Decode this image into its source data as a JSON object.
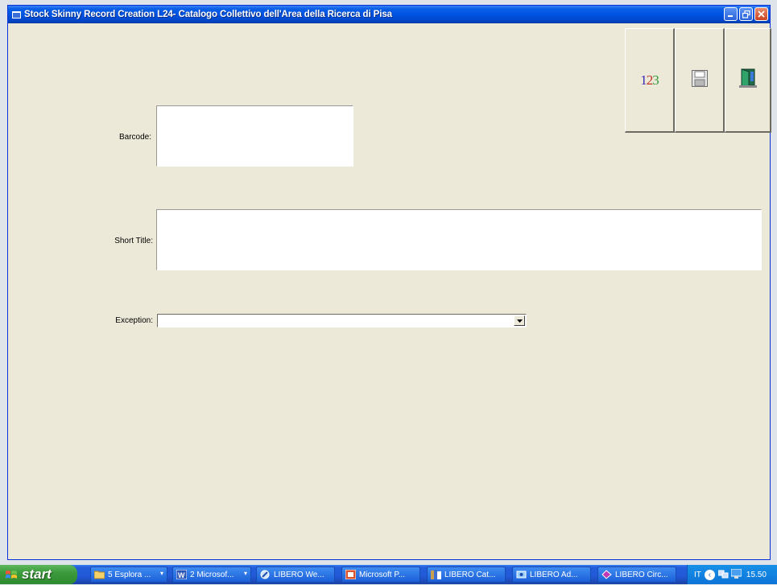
{
  "window": {
    "title": "Stock Skinny Record Creation L24- Catalogo Collettivo dell'Area della Ricerca di Pisa"
  },
  "toolbar": {
    "numbering_label": "123",
    "save_icon": "floppy-disk-icon",
    "exit_icon": "exit-door-icon"
  },
  "form": {
    "barcode_label": "Barcode:",
    "barcode_value": "",
    "short_title_label": "Short Title:",
    "short_title_value": "",
    "exception_label": "Exception:",
    "exception_value": ""
  },
  "taskbar": {
    "start_label": "start",
    "tasks": [
      {
        "label": "5 Esplora ...",
        "icon": "folder-icon"
      },
      {
        "label": "2 Microsof...",
        "icon": "word-icon"
      },
      {
        "label": "LIBERO We...",
        "icon": "libero-web-icon"
      },
      {
        "label": "Microsoft P...",
        "icon": "powerpoint-icon"
      },
      {
        "label": "LIBERO Cat...",
        "icon": "libero-cat-icon"
      },
      {
        "label": "LIBERO Ad...",
        "icon": "libero-admin-icon"
      },
      {
        "label": "LIBERO Circ...",
        "icon": "libero-circ-icon"
      }
    ],
    "tray": {
      "language": "IT",
      "clock": "15.50"
    }
  },
  "colors": {
    "window_bg": "#ece9d8",
    "titlebar_blue": "#0054e3",
    "taskbar_blue": "#245edb",
    "start_green": "#3c9a3c"
  }
}
